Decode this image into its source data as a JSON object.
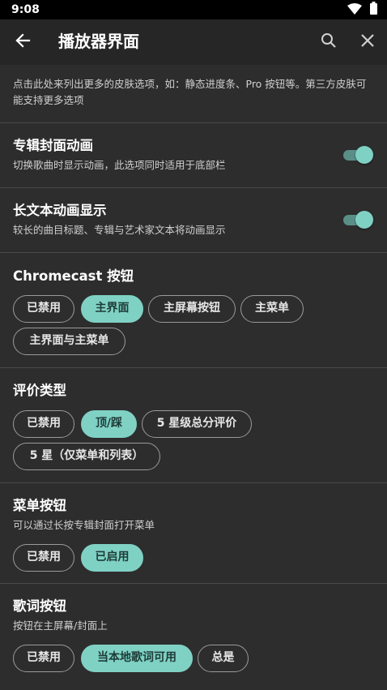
{
  "status_bar": {
    "time": "9:08"
  },
  "app_bar": {
    "title": "播放器界面"
  },
  "note": "点击此处来列出更多的皮肤选项，如：静态进度条、Pro 按钮等。第三方皮肤可能支持更多选项",
  "album_animation": {
    "title": "专辑封面动画",
    "subtitle": "切换歌曲时显示动画，此选项同时适用于底部栏",
    "enabled": true
  },
  "long_text_animation": {
    "title": "长文本动画显示",
    "subtitle": "较长的曲目标题、专辑与艺术家文本将动画显示",
    "enabled": true
  },
  "chromecast": {
    "title": "Chromecast 按钮",
    "options": [
      "已禁用",
      "主界面",
      "主屏幕按钮",
      "主菜单",
      "主界面与主菜单"
    ],
    "selected": "主界面"
  },
  "rating": {
    "title": "评价类型",
    "options": [
      "已禁用",
      "顶/踩",
      "5 星级总分评价",
      "5 星（仅菜单和列表）"
    ],
    "selected": "顶/踩"
  },
  "menu_button": {
    "title": "菜单按钮",
    "subtitle": "可以通过长按专辑封面打开菜单",
    "options": [
      "已禁用",
      "已启用"
    ],
    "selected": "已启用"
  },
  "lyrics_button": {
    "title": "歌词按钮",
    "subtitle": "按钮在主屏幕/封面上",
    "options": [
      "已禁用",
      "当本地歌词可用",
      "总是"
    ],
    "selected": "当本地歌词可用"
  },
  "colors": {
    "background": "#2d2d2d",
    "app_bar": "#262626",
    "accent": "#7fd1c4",
    "chip_border": "#9a9a9a"
  }
}
